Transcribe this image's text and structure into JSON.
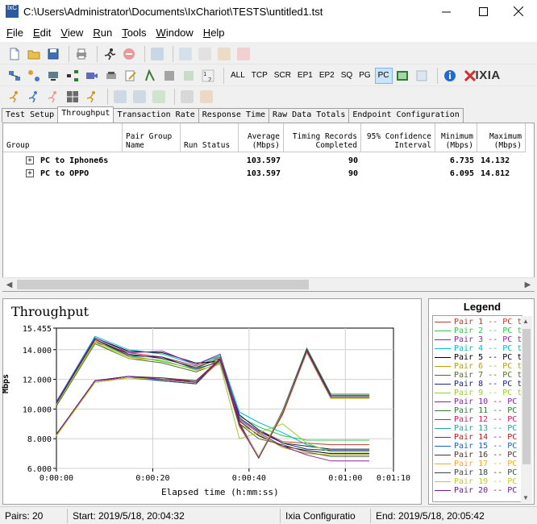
{
  "window": {
    "title": "C:\\Users\\Administrator\\Documents\\IxChariot\\TESTS\\untitled1.tst",
    "app_icon": "IxC"
  },
  "menu": [
    {
      "label": "File",
      "key": "F",
      "rest": "ile"
    },
    {
      "label": "Edit",
      "key": "E",
      "rest": "dit"
    },
    {
      "label": "View",
      "key": "V",
      "rest": "iew"
    },
    {
      "label": "Run",
      "key": "R",
      "rest": "un"
    },
    {
      "label": "Tools",
      "key": "T",
      "rest": "ools"
    },
    {
      "label": "Window",
      "key": "W",
      "rest": "indow"
    },
    {
      "label": "Help",
      "key": "H",
      "rest": "elp"
    }
  ],
  "toolbar2_text": [
    "ALL",
    "TCP",
    "SCR",
    "EP1",
    "EP2",
    "SQ",
    "PG",
    "PC"
  ],
  "toolbar2_active": "PC",
  "brand": "IXIA",
  "tabs": [
    "Test Setup",
    "Throughput",
    "Transaction Rate",
    "Response Time",
    "Raw Data Totals",
    "Endpoint Configuration"
  ],
  "active_tab": "Throughput",
  "grid": {
    "columns": [
      {
        "label": "Group"
      },
      {
        "label": "Pair Group\nName"
      },
      {
        "label": "Run Status"
      },
      {
        "label": "Average\n(Mbps)"
      },
      {
        "label": "Timing Records\nCompleted"
      },
      {
        "label": "95% Confidence\nInterval"
      },
      {
        "label": "Minimum\n(Mbps)"
      },
      {
        "label": "Maximum\n(Mbps)"
      }
    ],
    "rows": [
      {
        "group": "PC to Iphone6s",
        "average": "103.597",
        "records": "90",
        "minimum": "6.735",
        "maximum": "14.132"
      },
      {
        "group": "PC to OPPO",
        "average": "103.597",
        "records": "90",
        "minimum": "6.095",
        "maximum": "14.812"
      }
    ]
  },
  "chart_data": {
    "type": "line",
    "title": "Throughput",
    "xlabel": "Elapsed time (h:mm:ss)",
    "ylabel": "Mbps",
    "x_ticks": [
      "0:00:00",
      "0:00:20",
      "0:00:40",
      "0:01:00",
      "0:01:10"
    ],
    "y_ticks": [
      "15.455",
      "14.000",
      "12.000",
      "10.000",
      "8.000",
      "6.000"
    ],
    "ylim": [
      6.0,
      15.455
    ],
    "xlim": [
      0,
      70
    ],
    "grid": true,
    "x_seconds": [
      0,
      8,
      15,
      22,
      29,
      34,
      38,
      42,
      47,
      52,
      57,
      59,
      62,
      65
    ],
    "series": [
      {
        "name": "Pair 1",
        "color": "#c0392b",
        "values": [
          10.4,
          14.5,
          13.8,
          13.5,
          12.9,
          13.5,
          9.6,
          8.6,
          7.8,
          7.7,
          7.6,
          7.6,
          7.6,
          7.6
        ]
      },
      {
        "name": "Pair 2",
        "color": "#2ecc40",
        "values": [
          10.3,
          14.6,
          13.6,
          13.2,
          12.7,
          13.6,
          9.5,
          8.8,
          8.2,
          7.9,
          7.9,
          7.9,
          7.9,
          7.9
        ]
      },
      {
        "name": "Pair 3",
        "color": "#222222",
        "values": [
          10.4,
          14.7,
          13.7,
          13.4,
          12.8,
          13.4,
          9.4,
          8.5,
          7.7,
          7.5,
          7.3,
          7.3,
          7.3,
          7.3
        ]
      },
      {
        "name": "Pair 4",
        "color": "#00bcd4",
        "values": [
          10.5,
          14.9,
          14.0,
          13.7,
          13.0,
          13.6,
          9.8,
          9.1,
          8.4,
          7.6,
          7.2,
          7.2,
          7.2,
          7.2
        ]
      },
      {
        "name": "Pair 5",
        "color": "#000000",
        "values": [
          10.4,
          14.8,
          13.9,
          13.8,
          13.1,
          13.2,
          9.2,
          8.2,
          7.5,
          7.2,
          7.0,
          7.0,
          7.0,
          7.0
        ]
      },
      {
        "name": "Pair 6",
        "color": "#b8a000",
        "values": [
          10.3,
          14.6,
          13.5,
          13.3,
          12.6,
          13.3,
          9.0,
          8.3,
          7.4,
          7.0,
          6.9,
          6.9,
          6.9,
          6.9
        ]
      },
      {
        "name": "Pair 7",
        "color": "#556b2f",
        "values": [
          10.2,
          14.4,
          13.4,
          13.1,
          12.5,
          13.1,
          9.0,
          8.0,
          7.6,
          7.1,
          6.8,
          6.8,
          6.8,
          6.8
        ]
      },
      {
        "name": "Pair 8",
        "color": "#1a237e",
        "values": [
          10.4,
          14.7,
          13.6,
          13.5,
          12.7,
          13.2,
          9.6,
          8.6,
          7.7,
          7.3,
          7.2,
          7.2,
          7.2,
          7.2
        ]
      },
      {
        "name": "Pair 9",
        "color": "#9acd32",
        "values": [
          10.3,
          14.5,
          13.4,
          13.3,
          12.6,
          13.0,
          8.0,
          8.4,
          9.0,
          7.7,
          7.1,
          7.1,
          7.1,
          7.1
        ]
      },
      {
        "name": "Pair 10",
        "color": "#8e24aa",
        "values": [
          10.5,
          14.8,
          13.8,
          13.9,
          13.0,
          13.7,
          9.3,
          8.4,
          7.5,
          6.9,
          6.5,
          6.5,
          6.5,
          6.5
        ]
      },
      {
        "name": "Pair 11",
        "color": "#2e7d32",
        "values": [
          8.3,
          11.9,
          12.2,
          11.9,
          11.7,
          13.3,
          8.9,
          6.7,
          9.9,
          14.1,
          11.0,
          11.0,
          11.0,
          11.0
        ]
      },
      {
        "name": "Pair 12",
        "color": "#d81b60",
        "values": [
          8.3,
          11.9,
          12.1,
          12.0,
          11.8,
          13.4,
          9.0,
          6.8,
          9.8,
          14.0,
          10.9,
          10.9,
          10.9,
          10.9
        ]
      },
      {
        "name": "Pair 13",
        "color": "#26a69a",
        "values": [
          8.2,
          11.8,
          12.1,
          12.1,
          11.8,
          13.2,
          8.8,
          6.8,
          9.7,
          13.9,
          10.8,
          10.8,
          10.8,
          10.8
        ]
      },
      {
        "name": "Pair 14",
        "color": "#b71c1c",
        "values": [
          8.3,
          11.9,
          12.2,
          12.0,
          11.9,
          13.4,
          9.1,
          6.7,
          9.8,
          13.8,
          10.7,
          10.7,
          10.7,
          10.7
        ]
      },
      {
        "name": "Pair 15",
        "color": "#1565c0",
        "values": [
          8.2,
          11.8,
          12.1,
          11.9,
          11.7,
          13.3,
          8.9,
          6.8,
          9.7,
          13.9,
          10.9,
          10.9,
          10.9,
          10.9
        ]
      },
      {
        "name": "Pair 16",
        "color": "#4e342e",
        "values": [
          8.3,
          11.9,
          12.2,
          12.1,
          11.9,
          13.3,
          9.0,
          6.7,
          9.8,
          14.0,
          10.8,
          10.8,
          10.8,
          10.8
        ]
      },
      {
        "name": "Pair 17",
        "color": "#f9a825",
        "values": [
          8.2,
          11.8,
          12.1,
          12.0,
          11.8,
          13.2,
          8.8,
          6.8,
          9.6,
          13.8,
          10.8,
          10.8,
          10.8,
          10.8
        ]
      },
      {
        "name": "Pair 18",
        "color": "#37474f",
        "values": [
          8.3,
          11.9,
          12.2,
          11.9,
          11.7,
          13.4,
          9.0,
          6.7,
          9.9,
          14.0,
          10.9,
          10.9,
          10.9,
          10.9
        ]
      },
      {
        "name": "Pair 19",
        "color": "#c0ca33",
        "values": [
          8.2,
          11.8,
          12.1,
          12.0,
          11.8,
          13.3,
          8.9,
          6.8,
          9.8,
          13.9,
          10.7,
          10.7,
          10.7,
          10.7
        ]
      },
      {
        "name": "Pair 20",
        "color": "#6a1b9a",
        "values": [
          8.3,
          11.9,
          12.2,
          12.0,
          11.8,
          13.3,
          8.9,
          6.7,
          9.7,
          13.9,
          10.8,
          10.8,
          10.8,
          10.8
        ]
      }
    ]
  },
  "legend": {
    "title": "Legend",
    "items": [
      {
        "text": "Pair 1 -- PC t",
        "color": "#c0392b"
      },
      {
        "text": "Pair 2 -- PC t",
        "color": "#2ecc40"
      },
      {
        "text": "Pair 3 -- PC t",
        "color": "#8e24aa"
      },
      {
        "text": "Pair 4 -- PC t",
        "color": "#00bcd4"
      },
      {
        "text": "Pair 5 -- PC t",
        "color": "#000000"
      },
      {
        "text": "Pair 6 -- PC t",
        "color": "#b8a000"
      },
      {
        "text": "Pair 7 -- PC t",
        "color": "#556b2f"
      },
      {
        "text": "Pair 8 -- PC t",
        "color": "#1a237e"
      },
      {
        "text": "Pair 9 -- PC t",
        "color": "#9acd32"
      },
      {
        "text": "Pair 10 -- PC",
        "color": "#8e24aa"
      },
      {
        "text": "Pair 11 -- PC",
        "color": "#2e7d32"
      },
      {
        "text": "Pair 12 -- PC",
        "color": "#d81b60"
      },
      {
        "text": "Pair 13 -- PC",
        "color": "#26a69a"
      },
      {
        "text": "Pair 14 -- PC",
        "color": "#b71c1c"
      },
      {
        "text": "Pair 15 -- PC",
        "color": "#1565c0"
      },
      {
        "text": "Pair 16 -- PC",
        "color": "#4e342e"
      },
      {
        "text": "Pair 17 -- PC",
        "color": "#f9a825"
      },
      {
        "text": "Pair 18 -- PC",
        "color": "#37474f"
      },
      {
        "text": "Pair 19 -- PC",
        "color": "#c0ca33"
      },
      {
        "text": "Pair 20 -- PC",
        "color": "#6a1b9a"
      }
    ]
  },
  "status": {
    "pairs": "Pairs: 20",
    "start": "Start: 2019/5/18, 20:04:32",
    "config": "Ixia Configuratio",
    "end": "End: 2019/5/18, 20:05:42"
  }
}
